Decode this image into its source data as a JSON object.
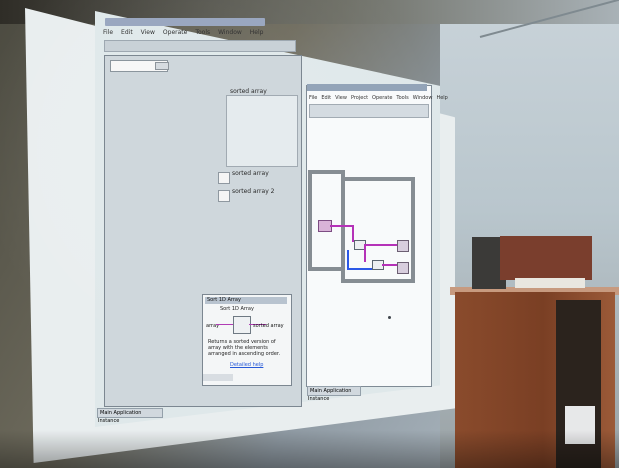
{
  "room": {
    "scene_colors": {
      "screen": "#e9eeef",
      "projection": "#dfe8ea",
      "wood": "#7a3f24",
      "wall": "#b9c6cd"
    }
  },
  "front_panel": {
    "menu": [
      "File",
      "Edit",
      "View",
      "Operate",
      "Tools",
      "Window",
      "Help"
    ],
    "array_label": "sorted array",
    "indicator_1": "sorted array",
    "indicator_2": "sorted array 2",
    "footer": "Main Application Instance"
  },
  "block_diagram": {
    "menu": [
      "File",
      "Edit",
      "View",
      "Project",
      "Operate",
      "Tools",
      "Window",
      "Help"
    ],
    "footer": "Main Application Instance"
  },
  "help": {
    "title": "Sort 1D Array",
    "heading": "Sort 1D Array",
    "left_label": "array",
    "right_label": "sorted array",
    "text": "Returns a sorted version of array with the elements arranged in ascending order.",
    "link": "Detailed help"
  }
}
